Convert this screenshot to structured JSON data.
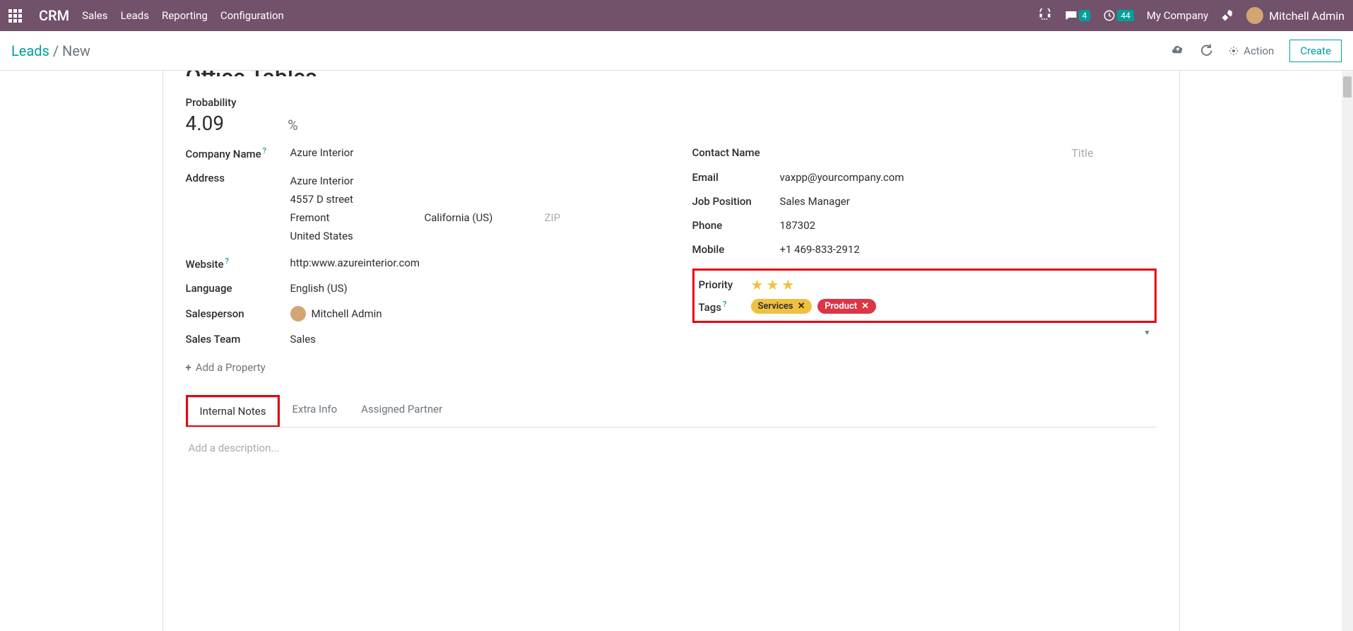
{
  "topbar": {
    "brand": "CRM",
    "nav": [
      "Sales",
      "Leads",
      "Reporting",
      "Configuration"
    ],
    "msg_badge": "4",
    "clock_badge": "44",
    "company": "My Company",
    "user": "Mitchell Admin"
  },
  "subbar": {
    "breadcrumb_root": "Leads",
    "breadcrumb_sep": " / ",
    "breadcrumb_current": "New",
    "action_label": "Action",
    "create_label": "Create"
  },
  "form": {
    "title": "Office Tables",
    "probability_label": "Probability",
    "probability_value": "4.09",
    "probability_unit": "%",
    "left": {
      "company_label": "Company Name",
      "company_value": "Azure Interior",
      "address_label": "Address",
      "address": {
        "name": "Azure Interior",
        "street": "4557 D street",
        "city": "Fremont",
        "state": "California (US)",
        "zip_placeholder": "ZIP",
        "country": "United States"
      },
      "website_label": "Website",
      "website_value": "http:www.azureinterior.com",
      "language_label": "Language",
      "language_value": "English (US)",
      "salesperson_label": "Salesperson",
      "salesperson_value": "Mitchell Admin",
      "salesteam_label": "Sales Team",
      "salesteam_value": "Sales",
      "addprop_label": "Add a Property"
    },
    "right": {
      "contact_label": "Contact Name",
      "title_placeholder": "Title",
      "email_label": "Email",
      "email_value": "vaxpp@yourcompany.com",
      "job_label": "Job Position",
      "job_value": "Sales Manager",
      "phone_label": "Phone",
      "phone_value": "187302",
      "mobile_label": "Mobile",
      "mobile_value": "+1 469-833-2912",
      "priority_label": "Priority",
      "priority_stars": 3,
      "tags_label": "Tags",
      "tags": [
        {
          "name": "Services",
          "color": "yellow"
        },
        {
          "name": "Product",
          "color": "red"
        }
      ]
    },
    "tabs": [
      "Internal Notes",
      "Extra Info",
      "Assigned Partner"
    ],
    "active_tab": 0,
    "description_placeholder": "Add a description..."
  }
}
